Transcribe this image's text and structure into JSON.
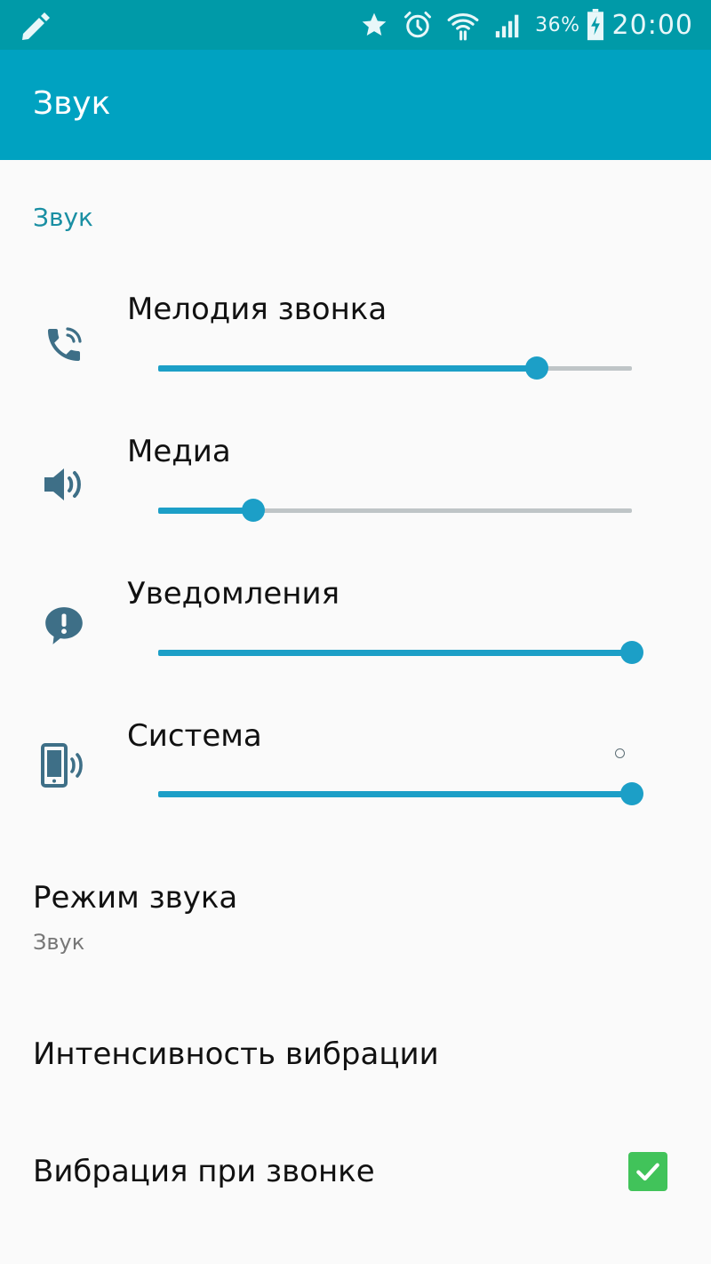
{
  "status_bar": {
    "battery_percent": "36%",
    "time": "20:00",
    "icons": [
      "pencil-icon",
      "star-icon",
      "alarm-icon",
      "wifi-icon",
      "signal-icon",
      "battery-charging-icon"
    ]
  },
  "app_bar": {
    "title": "Звук"
  },
  "section": {
    "header": "Звук"
  },
  "volume": [
    {
      "label": "Мелодия звонка",
      "icon": "ringtone-phone-icon",
      "level": 0.8
    },
    {
      "label": "Медиа",
      "icon": "speaker-icon",
      "level": 0.2
    },
    {
      "label": "Уведомления",
      "icon": "notification-icon",
      "level": 1.0
    },
    {
      "label": "Система",
      "icon": "system-phone-icon",
      "level": 1.0
    }
  ],
  "settings": {
    "sound_mode": {
      "title": "Режим звука",
      "value": "Звук"
    },
    "vibration_intensity": {
      "title": "Интенсивность вибрации"
    },
    "vibrate_on_ring": {
      "title": "Вибрация при звонке",
      "checked": true
    }
  },
  "colors": {
    "status_bar": "#009aa8",
    "app_bar": "#00a2c1",
    "accent": "#1c9fc7",
    "icon": "#3e6f87",
    "checkbox": "#41c35a"
  }
}
